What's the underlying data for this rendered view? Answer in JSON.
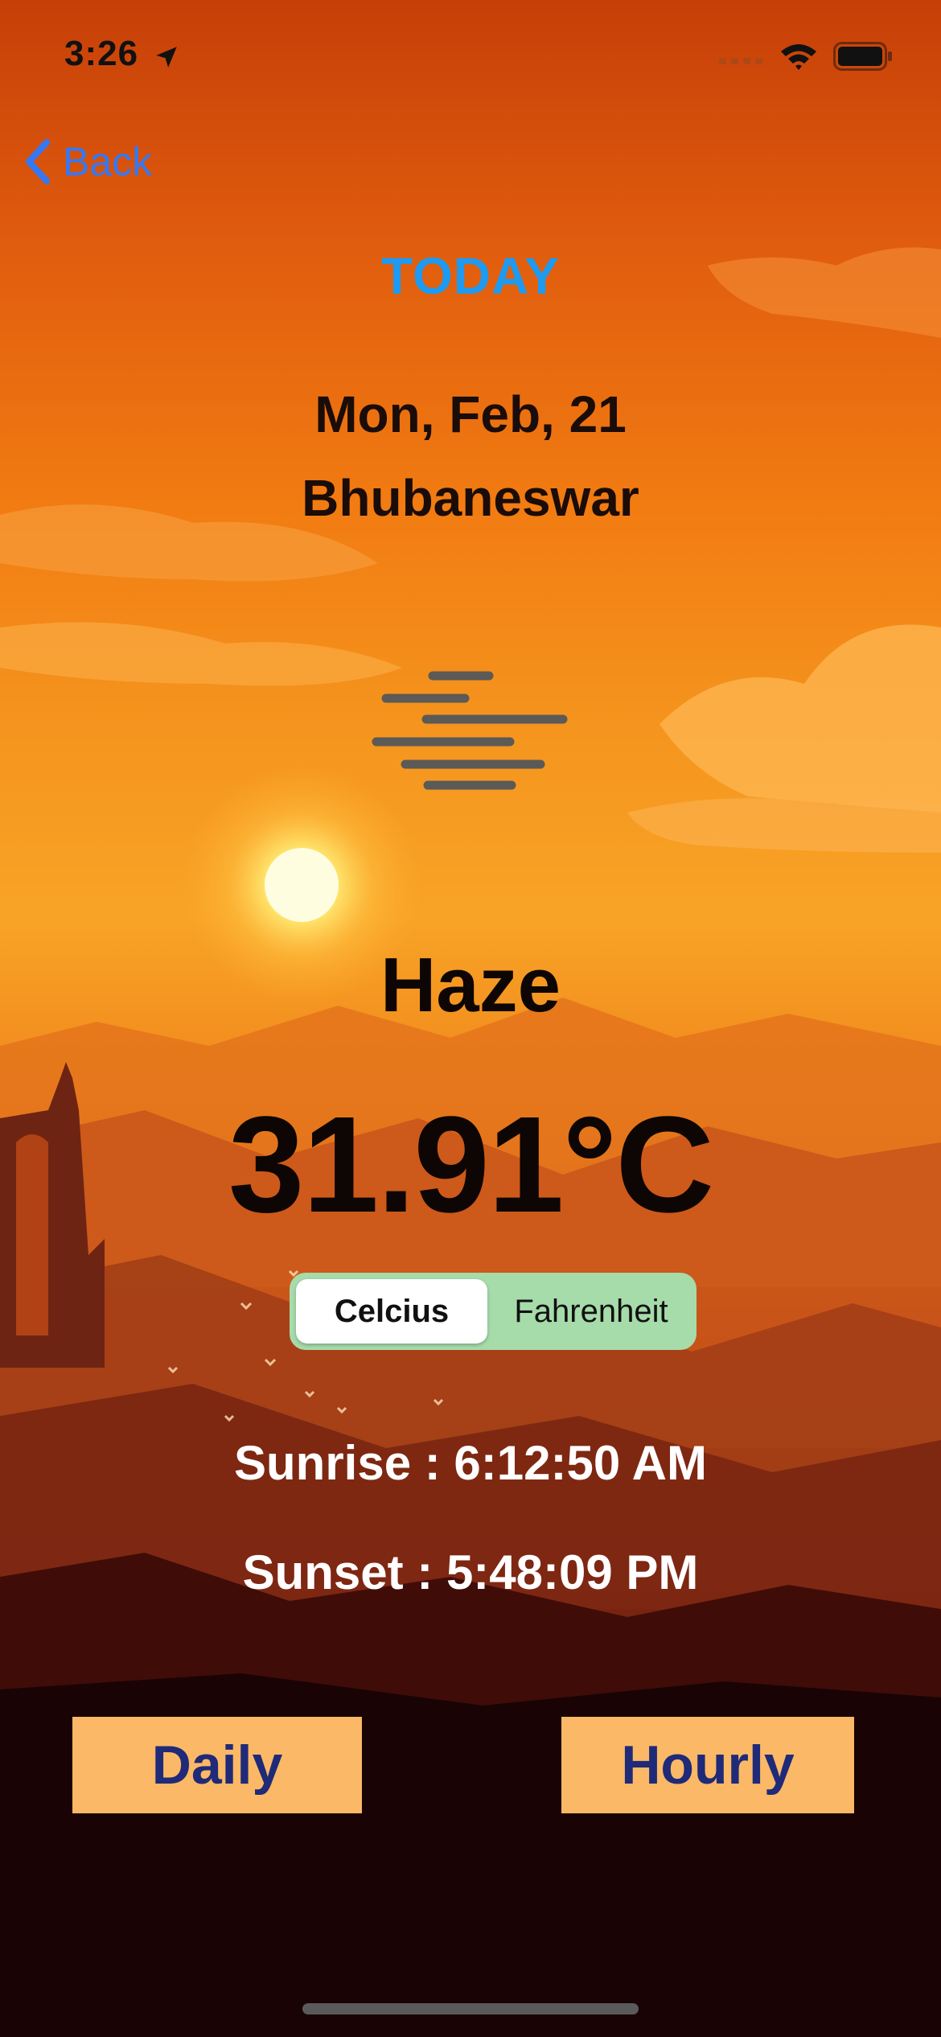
{
  "status_bar": {
    "time": "3:26"
  },
  "nav": {
    "back_label": "Back"
  },
  "header": {
    "title": "TODAY"
  },
  "weather": {
    "date": "Mon, Feb, 21",
    "city": "Bhubaneswar",
    "icon": "haze-icon",
    "condition": "Haze",
    "temperature": "31.91°C"
  },
  "unit_toggle": {
    "options": [
      "Celcius",
      "Fahrenheit"
    ],
    "selected": "Celcius"
  },
  "sun": {
    "sunrise": "Sunrise : 6:12:50 AM",
    "sunset": "Sunset : 5:48:09 PM"
  },
  "actions": {
    "daily_label": "Daily",
    "hourly_label": "Hourly"
  },
  "colors": {
    "accent": "#1e9af0",
    "button_bg": "#fbb866",
    "button_text": "#1f2a78",
    "toggle_bg": "#a6dbaa",
    "back_link": "#3478f6"
  }
}
